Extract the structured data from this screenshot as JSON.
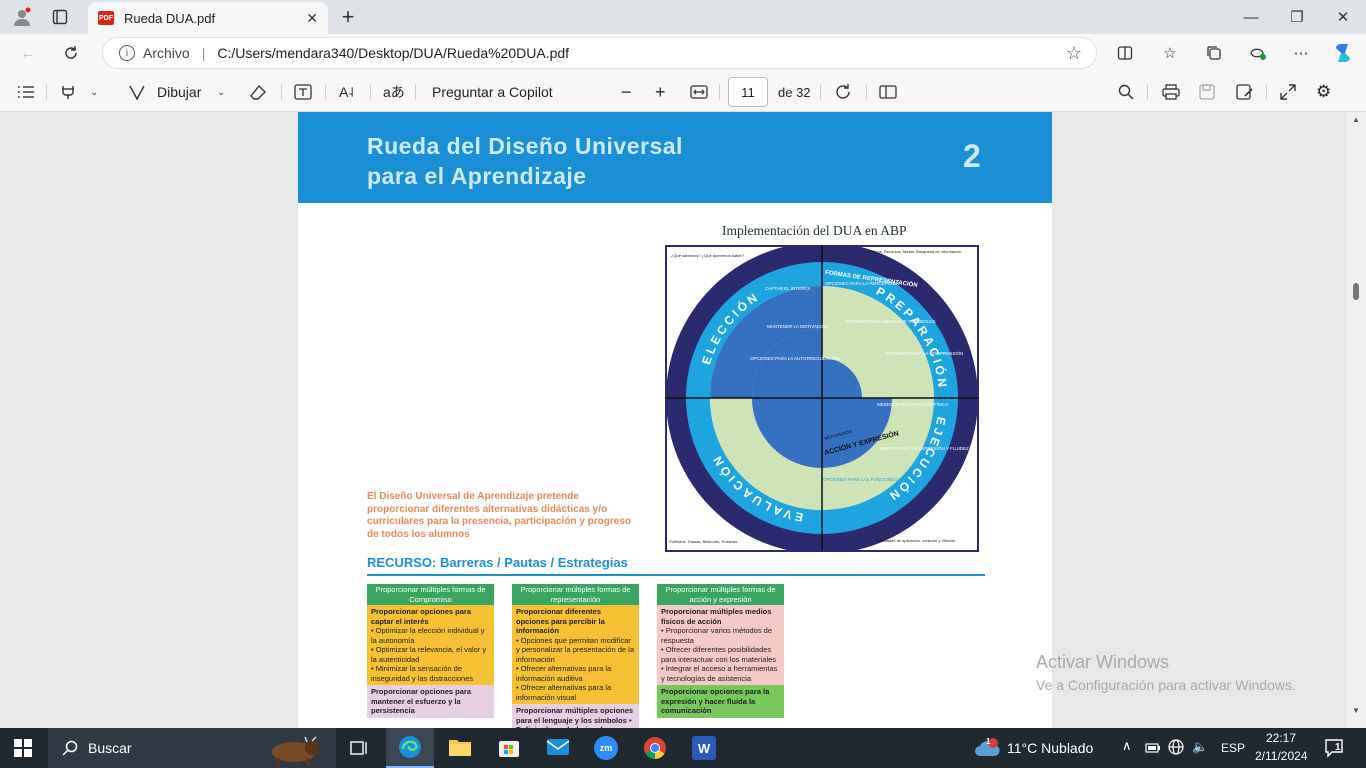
{
  "browser": {
    "tab_title": "Rueda DUA.pdf",
    "tab_close": "✕",
    "new_tab": "+",
    "url_label": "Archivo",
    "url": "C:/Users/mendara340/Desktop/DUA/Rueda%20DUA.pdf",
    "win_min": "—",
    "win_max": "❐",
    "win_close": "✕"
  },
  "pdf_toolbar": {
    "draw": "Dibujar",
    "ask_copilot": "Preguntar a Copilot",
    "page_current": "11",
    "page_total": "de 32",
    "zoom_out": "−",
    "zoom_in": "+"
  },
  "page": {
    "banner_title_line1": "Rueda del Diseño Universal",
    "banner_title_line2": "para el Aprendizaje",
    "banner_number": "2",
    "wheel_title": "Implementación del DUA en ABP",
    "wheel": {
      "corner_tl": "¿Qué sabemos? ¿Qué queremos saber?",
      "corner_tr": "Objetivos, Recursos, Metas, Búsqueda de información",
      "corner_bl": "Portfolios, Dianas, Bitácoras, Rúbricas",
      "corner_br": "Actividades de aplicación, creación y difusión",
      "q_eleccion": "ELECCIÓN",
      "q_preparacion": "PREPARACIÓN",
      "q_evaluacion": "EVALUACIÓN",
      "q_ejecucion": "EJECUCIÓN",
      "formas_rep": "FORMAS DE REPRESENTACIÓN",
      "accion_expresion": "ACCIÓN Y EXPRESIÓN",
      "motivacion": "MOTIVACIÓN",
      "captar": "CAPTAR EL INTERÉS",
      "mantener": "MANTENER LA MOTIVACIÓN",
      "autoreg": "OPCIONES PARA LA AUTORREGULACIÓN",
      "percepcion": "OPCIONES PARA LA PERCEPCIÓN",
      "lenguaje": "OPCIONES PARA LENGUAJE Y SÍMBOLOS",
      "comprension": "OPCIONES PARA LA COMPRENSIÓN",
      "fisica": "MEDIOS PARA LA ACCIÓN FÍSICA",
      "expresion": "MEDIOS PARA LA EXPRESIÓN Y FLUIDEZ",
      "ejecutivas": "OPCIONES PARA LAS FUNCIONES EJECUTIVAS"
    },
    "intro": "El Diseño Universal de Aprendizaje pretende proporcionar diferentes alternativas didácticas y/o curriculares para la presencia, participación y progreso de todos los alumnos",
    "resource_heading": "RECURSO: Barreras / Pautas / Estrategias",
    "tables": [
      {
        "header": "Proporcionar múltiples formas de Compromiso",
        "head_color": "#3aa561",
        "body_color": "#f7c136",
        "title": "Proporcionar opciones para captar el interés",
        "bullets": [
          "• Optimizar la elección individual y la autonomía",
          "• Optimizar la relevancia, el valor y la autenticidad",
          "• Minimizar la sensación de inseguridad y las distracciones"
        ],
        "next_color": "#e6cfe3",
        "next": "Proporcionar opciones para mantener el esfuerzo y la persistencia"
      },
      {
        "header": "Proporcionar múltiples formas de representación",
        "head_color": "#3aa561",
        "body_color": "#f7c136",
        "title": "Proporcionar diferentes opciones para percibir la información",
        "bullets": [
          "• Opciones que permitan modificar y personalizar la presentación de la información",
          "• Ofrecer alternativas para la información auditiva",
          "• Ofrecer alternativas para la información visual"
        ],
        "next_color": "#e6cfe3",
        "next": "Proporcionar múltiples opciones para el lenguaje y los símbolos • Definir el vocabulario y los"
      },
      {
        "header": "Proporcionar múltiples formas de acción y expresión",
        "head_color": "#3aa561",
        "body_color": "#f5c9c6",
        "title": "Proporcionar múltiples medios físicos de acción",
        "bullets": [
          "• Proporcionar varios métodos de respuesta",
          "• Ofrecer diferentes posibilidades para interactuar con los materiales",
          "• Integrar el acceso a herramientas y tecnologías de asistencia"
        ],
        "next_color": "#79c85e",
        "next": "Proporcionar opciones para la expresión y hacer fluida la comunicación"
      }
    ]
  },
  "watermark": {
    "line1": "Activar Windows",
    "line2": "Ve a Configuración para activar Windows."
  },
  "taskbar": {
    "search": "Buscar",
    "weather": "11°C  Nublado",
    "lang": "ESP",
    "time": "22:17",
    "date": "2/11/2024",
    "notif": "1",
    "weather_badge": "1"
  }
}
